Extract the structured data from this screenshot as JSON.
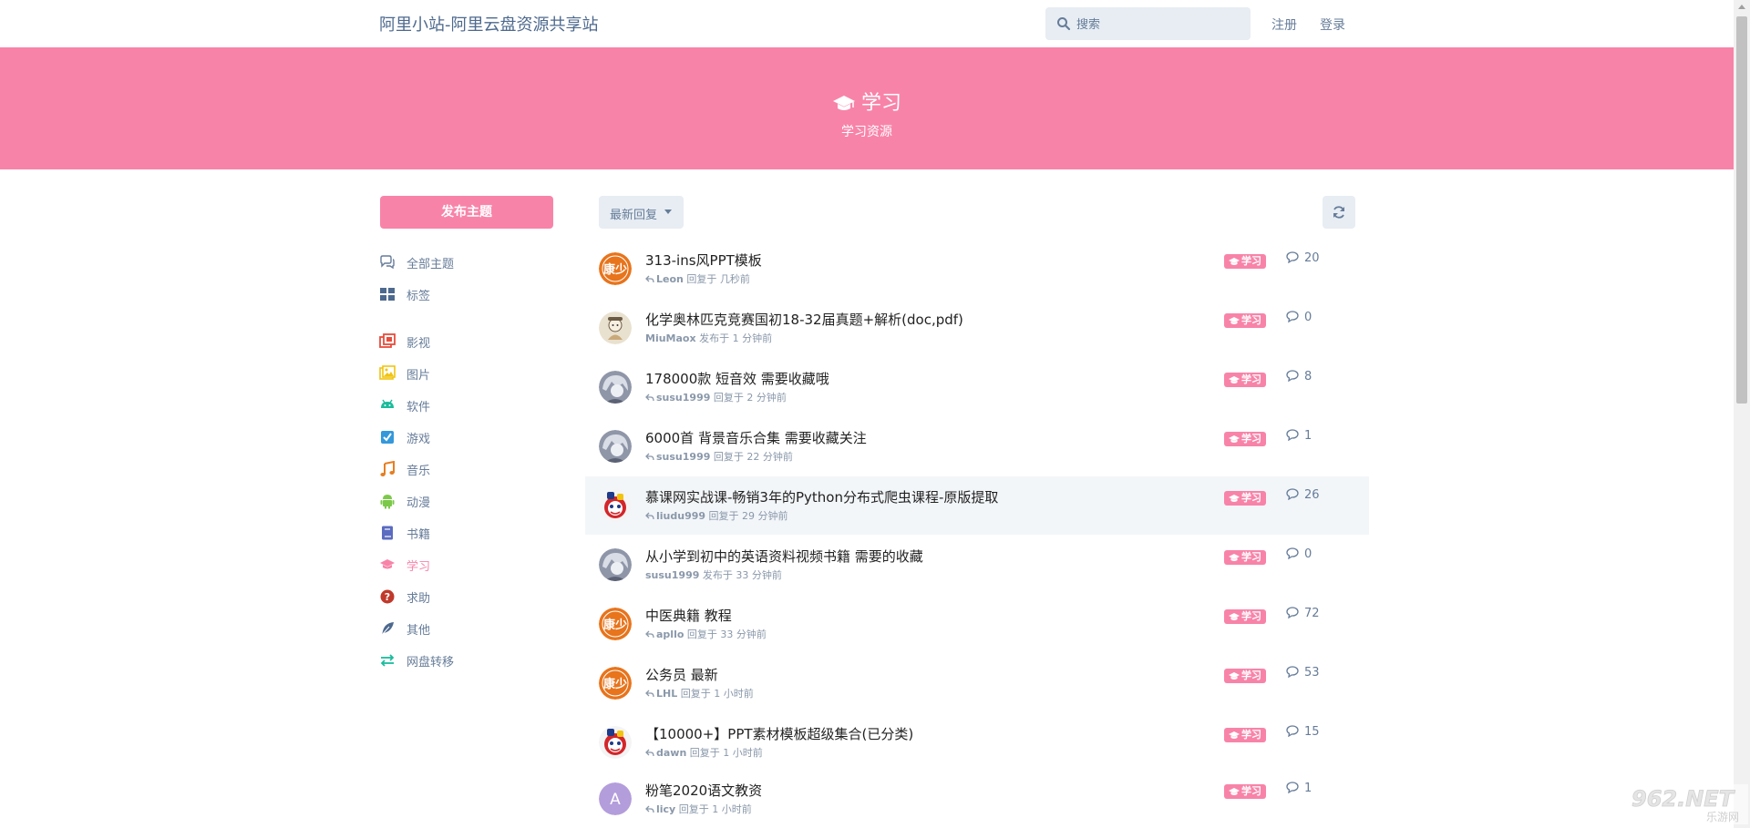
{
  "header": {
    "site_title": "阿里小站-阿里云盘资源共享站",
    "search_placeholder": "搜索",
    "register": "注册",
    "login": "登录"
  },
  "hero": {
    "title": "学习",
    "description": "学习资源"
  },
  "sidebar": {
    "new_topic": "发布主题",
    "nav": [
      {
        "label": "全部主题",
        "icon": "comments-icon"
      },
      {
        "label": "标签",
        "icon": "tags-grid-icon"
      }
    ],
    "tags": [
      {
        "label": "影视",
        "icon": "film-icon",
        "color": "#e74c3c"
      },
      {
        "label": "图片",
        "icon": "image-icon",
        "color": "#f1c40f"
      },
      {
        "label": "软件",
        "icon": "android-icon",
        "color": "#1abc9c"
      },
      {
        "label": "游戏",
        "icon": "gamepad-icon",
        "color": "#3498db"
      },
      {
        "label": "音乐",
        "icon": "music-icon",
        "color": "#e67e22"
      },
      {
        "label": "动漫",
        "icon": "android-robot-icon",
        "color": "#7cc94a"
      },
      {
        "label": "书籍",
        "icon": "book-icon",
        "color": "#5b6bc0"
      },
      {
        "label": "学习",
        "icon": "graduation-cap-icon",
        "color": "#f883a9"
      },
      {
        "label": "求助",
        "icon": "question-icon",
        "color": "#c0392b"
      },
      {
        "label": "其他",
        "icon": "feather-icon",
        "color": "#4d698e"
      },
      {
        "label": "网盘转移",
        "icon": "exchange-icon",
        "color": "#1abc9c"
      }
    ]
  },
  "toolbar": {
    "sort_label": "最新回复"
  },
  "discussions": [
    {
      "title": "313-ins风PPT模板",
      "user": "Leon",
      "action": "回复于",
      "time": "几秒前",
      "replied": true,
      "tag": "学习",
      "count": "20",
      "avatar": "orange-text",
      "avatar_text": "康少"
    },
    {
      "title": "化学奥林匹克竞赛国初18-32届真题+解析(doc,pdf)",
      "user": "MiuMaox",
      "action": "发布于",
      "time": "1 分钟前",
      "replied": false,
      "tag": "学习",
      "count": "0",
      "avatar": "cartoon"
    },
    {
      "title": "178000款 短音效 需要收藏哦",
      "user": "susu1999",
      "action": "回复于",
      "time": "2 分钟前",
      "replied": true,
      "tag": "学习",
      "count": "8",
      "avatar": "anime"
    },
    {
      "title": "6000首 背景音乐合集 需要收藏关注",
      "user": "susu1999",
      "action": "回复于",
      "time": "22 分钟前",
      "replied": true,
      "tag": "学习",
      "count": "1",
      "avatar": "anime"
    },
    {
      "title": "慕课网实战课-畅销3年的Python分布式爬虫课程-原版提取",
      "user": "liudu999",
      "action": "回复于",
      "time": "29 分钟前",
      "replied": true,
      "tag": "学习",
      "count": "26",
      "avatar": "mascot"
    },
    {
      "title": "从小学到初中的英语资料视频书籍 需要的收藏",
      "user": "susu1999",
      "action": "发布于",
      "time": "33 分钟前",
      "replied": false,
      "tag": "学习",
      "count": "0",
      "avatar": "anime"
    },
    {
      "title": "中医典籍 教程",
      "user": "apllo",
      "action": "回复于",
      "time": "33 分钟前",
      "replied": true,
      "tag": "学习",
      "count": "72",
      "avatar": "orange-text",
      "avatar_text": "康少"
    },
    {
      "title": "公务员 最新",
      "user": "LHL",
      "action": "回复于",
      "time": "1 小时前",
      "replied": true,
      "tag": "学习",
      "count": "53",
      "avatar": "orange-text",
      "avatar_text": "康少"
    },
    {
      "title": "【10000+】PPT素材模板超级集合(已分类)",
      "user": "dawn",
      "action": "回复于",
      "time": "1 小时前",
      "replied": true,
      "tag": "学习",
      "count": "15",
      "avatar": "mascot"
    },
    {
      "title": "粉笔2020语文教资",
      "user": "licy",
      "action": "回复于",
      "time": "1 小时前",
      "replied": true,
      "tag": "学习",
      "count": "1",
      "avatar": "letter",
      "avatar_text": "A"
    }
  ],
  "watermark": {
    "brand": "962.NET",
    "sub": "乐游网"
  },
  "colors": {
    "primary": "#f883a9",
    "link": "#667c99",
    "control_bg": "#e7edf3"
  }
}
